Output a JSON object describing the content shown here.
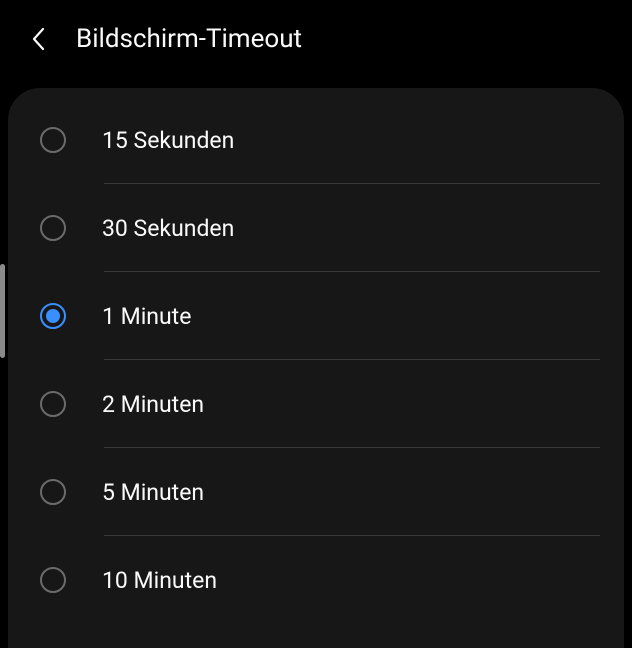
{
  "header": {
    "title": "Bildschirm-Timeout"
  },
  "options": [
    {
      "label": "15 Sekunden",
      "selected": false
    },
    {
      "label": "30 Sekunden",
      "selected": false
    },
    {
      "label": "1 Minute",
      "selected": true
    },
    {
      "label": "2 Minuten",
      "selected": false
    },
    {
      "label": "5 Minuten",
      "selected": false
    },
    {
      "label": "10 Minuten",
      "selected": false
    }
  ]
}
